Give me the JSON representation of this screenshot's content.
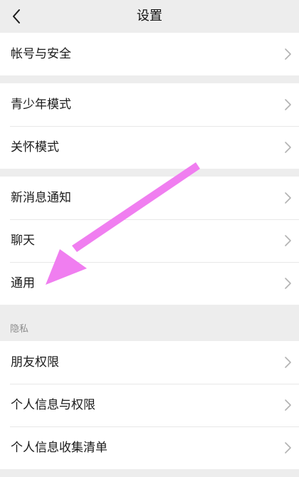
{
  "header": {
    "title": "设置"
  },
  "groups": [
    {
      "items": [
        "帐号与安全"
      ]
    },
    {
      "items": [
        "青少年模式",
        "关怀模式"
      ]
    },
    {
      "items": [
        "新消息通知",
        "聊天",
        "通用"
      ]
    },
    {
      "header": "隐私",
      "items": [
        "朋友权限",
        "个人信息与权限",
        "个人信息收集清单"
      ]
    }
  ],
  "icons": {
    "back": "chevron-left-icon",
    "row": "chevron-right-icon"
  },
  "colors": {
    "background": "#ededed",
    "row_background": "#ffffff",
    "annotation_arrow": "#f07ef0"
  }
}
